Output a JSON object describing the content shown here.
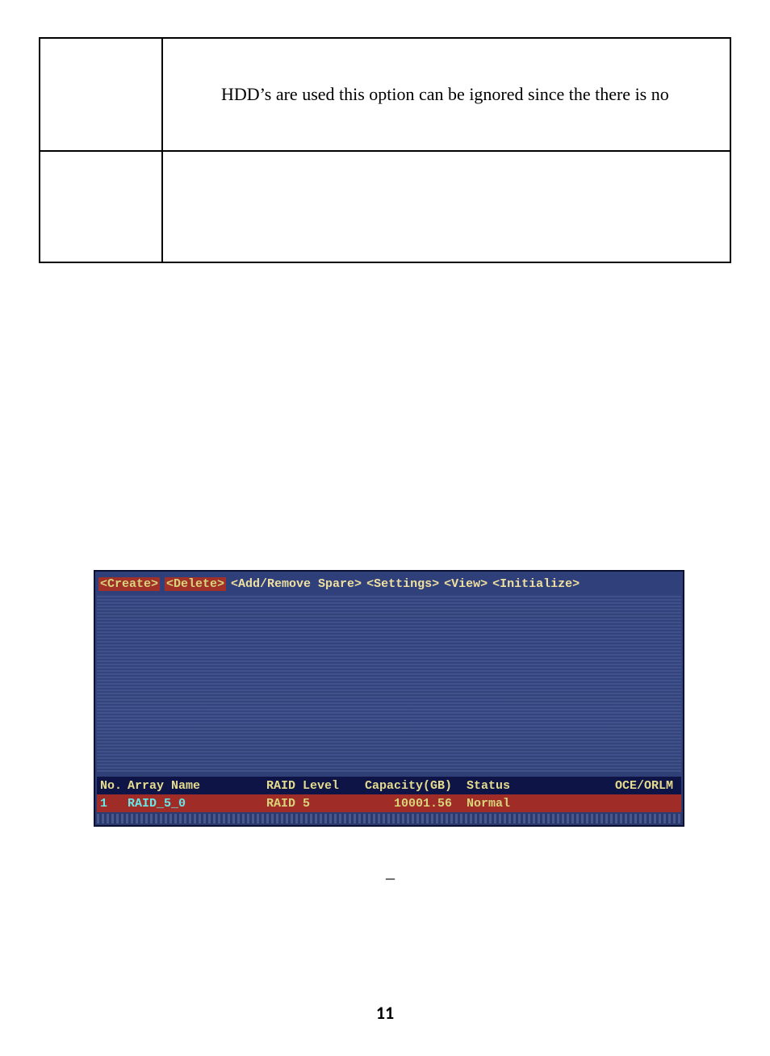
{
  "doc": {
    "row1_text": "HDD’s are used this option can be ignored since the there is no"
  },
  "bios": {
    "menu": {
      "create": "<Create>",
      "delete": "<Delete>",
      "addremove": "<Add/Remove Spare>",
      "settings": "<Settings>",
      "view": "<View>",
      "initialize": "<Initialize>"
    },
    "headers": {
      "no": "No.",
      "name": "Array Name",
      "level": "RAID Level",
      "cap": "Capacity(GB)",
      "status": "Status",
      "oce": "OCE/ORLM"
    },
    "row": {
      "no": "1",
      "name": "RAID_5_0",
      "level": "RAID 5",
      "cap": "10001.56",
      "status": "Normal",
      "oce": ""
    }
  },
  "marks": {
    "dash": "–"
  },
  "page_number": "11"
}
